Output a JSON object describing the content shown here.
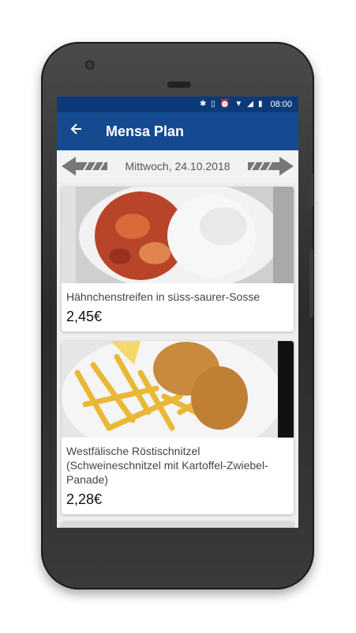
{
  "status_bar": {
    "time": "08:00",
    "icons": [
      "bluetooth-icon",
      "vibrate-icon",
      "alarm-icon",
      "wifi-icon",
      "lte-signal-icon",
      "battery-icon"
    ]
  },
  "app_bar": {
    "title": "Mensa Plan",
    "back_icon": "arrow-left-icon"
  },
  "date_nav": {
    "date": "Mittwoch, 24.10.2018",
    "prev_icon": "arrow-prev-icon",
    "next_icon": "arrow-next-icon"
  },
  "meals": [
    {
      "name": "Hähnchenstreifen in süss-saurer-Sosse",
      "price": "2,45€"
    },
    {
      "name": "Westfälische Röstischnitzel (Schweineschnitzel mit Kartoffel-Zwiebel-Panade)",
      "price": "2,28€"
    }
  ],
  "colors": {
    "status_bar": "#0c3a78",
    "app_bar": "#154a91",
    "background": "#eeeeee"
  }
}
